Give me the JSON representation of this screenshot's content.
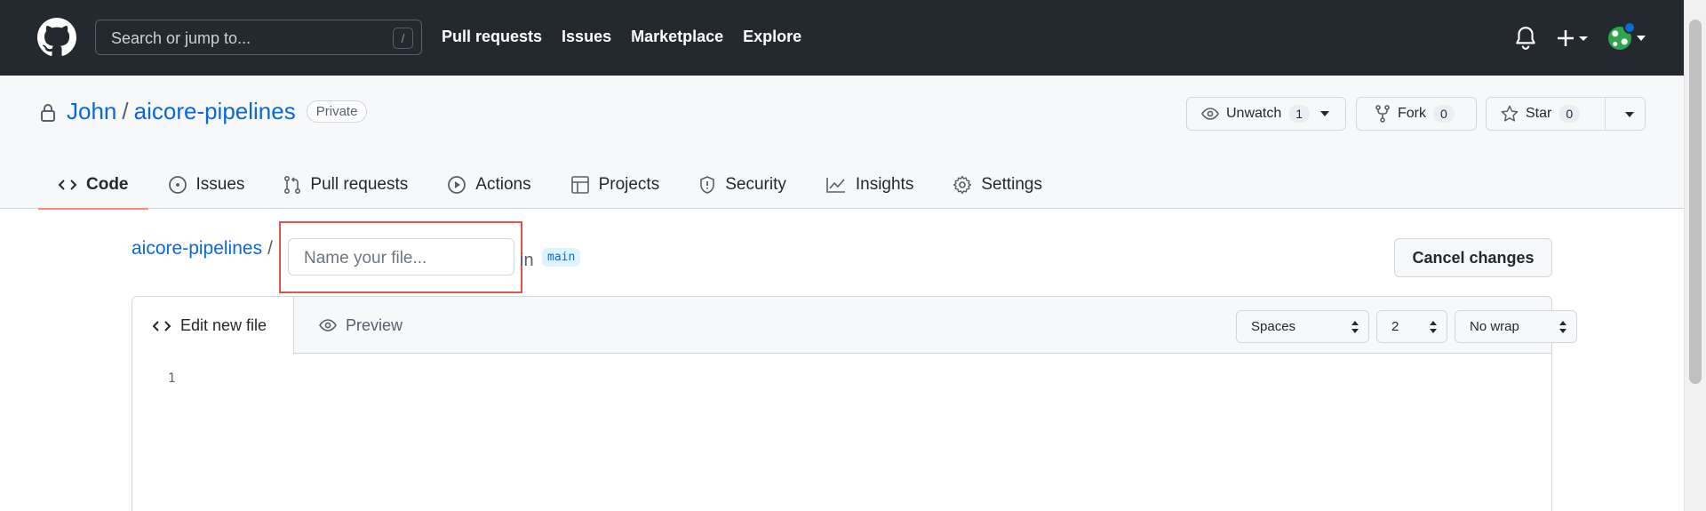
{
  "header": {
    "search_placeholder": "Search or jump to...",
    "search_shortcut": "/",
    "nav": [
      "Pull requests",
      "Issues",
      "Marketplace",
      "Explore"
    ]
  },
  "repo": {
    "owner": "John",
    "name": "aicore-pipelines",
    "visibility": "Private",
    "watch": {
      "label": "Unwatch",
      "count": "1"
    },
    "fork": {
      "label": "Fork",
      "count": "0"
    },
    "star": {
      "label": "Star",
      "count": "0"
    },
    "tabs": [
      {
        "label": "Code",
        "icon": "code-icon"
      },
      {
        "label": "Issues",
        "icon": "issue-icon"
      },
      {
        "label": "Pull requests",
        "icon": "pull-request-icon"
      },
      {
        "label": "Actions",
        "icon": "play-icon"
      },
      {
        "label": "Projects",
        "icon": "table-icon"
      },
      {
        "label": "Security",
        "icon": "shield-icon"
      },
      {
        "label": "Insights",
        "icon": "graph-icon"
      },
      {
        "label": "Settings",
        "icon": "gear-icon"
      }
    ]
  },
  "editor": {
    "breadcrumb_repo": "aicore-pipelines",
    "breadcrumb_sep": "/",
    "filename_placeholder": "Name your file...",
    "in_label": "in",
    "branch": "main",
    "cancel_label": "Cancel changes",
    "tab_edit": "Edit new file",
    "tab_preview": "Preview",
    "indent_mode": "Spaces",
    "indent_size": "2",
    "wrap_mode": "No wrap",
    "line_numbers": [
      "1"
    ]
  },
  "colors": {
    "header_bg": "#24292f",
    "link": "#0969da",
    "active_tab_underline": "#fd8c73",
    "highlight_box": "#e5534b"
  }
}
